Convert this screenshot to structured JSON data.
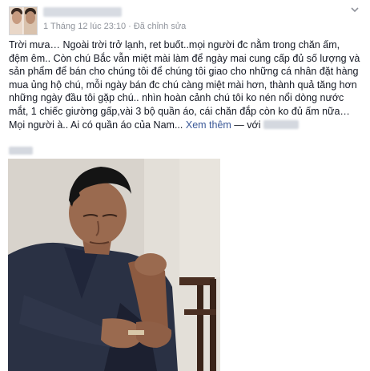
{
  "post": {
    "timestamp": "1 Tháng 12 lúc 23:10",
    "separator": "·",
    "edited": "Đã chỉnh sửa",
    "body": "Trời mưa… Ngoài trời trở lạnh, ret buốt..mọi người đc nằm trong chăn ấm, đệm êm.. Còn chú Bắc vẫn miệt mài làm để ngày mai cung cấp đủ số lượng và sản phẩm để bán cho chúng tôi để chúng tôi giao cho những cá nhân đặt hàng mua ủng hộ chú, mỗi ngày bán đc chú càng miệt mài hơn, thành quả tăng hơn những ngày đầu tôi gặp chú.. nhìn hoàn cảnh chú tôi ko nén nổi dòng nước mắt, 1 chiếc giường gấp,vài 3 bộ quần áo, cái chăn đắp còn ko đủ ấm nữa…Mọi người à.. Ai có quần áo của Nam...",
    "see_more": "Xem thêm",
    "with_label": " — với"
  },
  "icons": {
    "menu": "chevron-down-icon"
  },
  "colors": {
    "link": "#3b5998",
    "meta": "#90949c",
    "text": "#141823"
  }
}
